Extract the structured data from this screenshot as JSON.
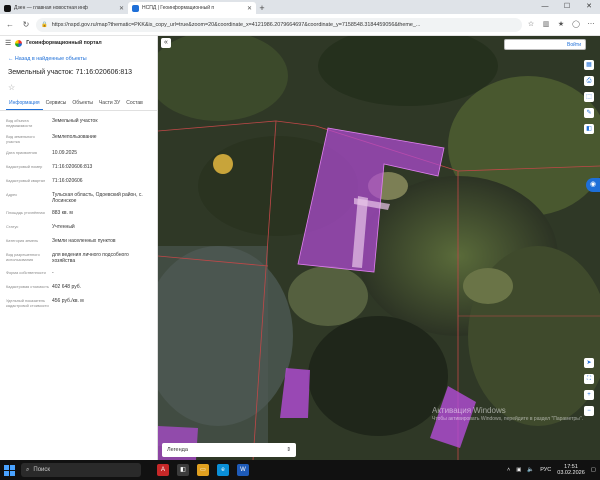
{
  "browser": {
    "tabs": [
      {
        "title": "Дзен — главная новостная инф",
        "active": false
      },
      {
        "title": "НСПД | Геоинформационный п",
        "active": true
      }
    ],
    "new_tab": "+",
    "url": "https://nspd.gov.ru/map?thematic=PKK&is_copy_url=true&zoom=20&coordinate_x=4121986.2079664697&coordinate_y=7158548.3184459056&theme_..."
  },
  "portal": {
    "title": "Геоинформационный портал",
    "back_link": "Назад в найденные объекты",
    "parcel_title": "Земельный участок: 71:16:020606:813",
    "tabs": [
      "Информация",
      "Сервисы",
      "Объекты",
      "Части ЗУ",
      "Состав"
    ],
    "properties": [
      {
        "label": "Вид объекта недвижимости",
        "value": "Земельный участок"
      },
      {
        "label": "Вид земельного участка",
        "value": "Землепользование"
      },
      {
        "label": "Дата присвоения",
        "value": "10.09.2025"
      },
      {
        "label": "Кадастровый номер",
        "value": "71:16:020606:813"
      },
      {
        "label": "Кадастровый квартал",
        "value": "71:16:020606"
      },
      {
        "label": "Адрес",
        "value": "Тульская область, Одоевский район, с. Лосинское"
      },
      {
        "label": "Площадь уточнённая",
        "value": "883 кв. м"
      },
      {
        "label": "Статус",
        "value": "Учтенный"
      },
      {
        "label": "Категория земель",
        "value": "Земли населенных пунктов"
      },
      {
        "label": "Вид разрешенного использования",
        "value": "для ведения личного подсобного хозяйства"
      },
      {
        "label": "Форма собственности",
        "value": "-"
      },
      {
        "label": "Кадастровая стоимость",
        "value": "402 648 руб."
      },
      {
        "label": "Удельный показатель кадастровой стоимости",
        "value": "456 руб./кв. м"
      }
    ]
  },
  "map": {
    "search_label": "Войти",
    "legend_label": "Легенда",
    "watermark_title": "Активация Windows",
    "watermark_text": "Чтобы активировать Windows, перейдите в раздел \"Параметры\"."
  },
  "taskbar": {
    "search_placeholder": "Поиск",
    "lang": "РУС",
    "time": "17:51",
    "date": "03.02.2026"
  },
  "colors": {
    "accent": "#1e6fd8",
    "parcel_fill": "#b44cd8",
    "parcel_border": "#c04848"
  }
}
